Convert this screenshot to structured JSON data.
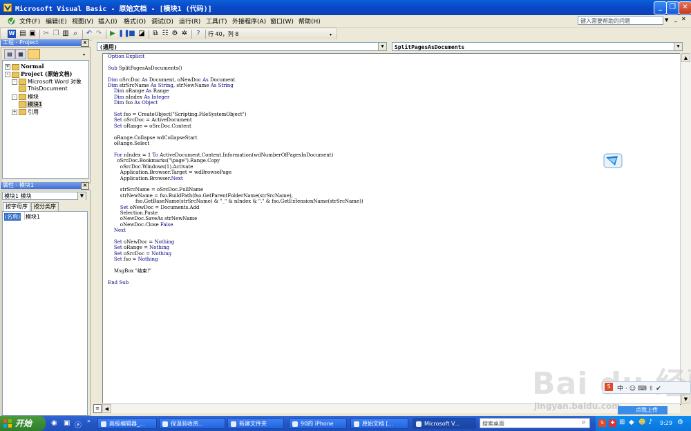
{
  "window": {
    "title": "Microsoft Visual Basic - 原始文档 - [模块1 (代码)]",
    "minimize": "_",
    "restore": "❐",
    "close": "✕"
  },
  "menu": {
    "items": [
      "文件(F)",
      "编辑(E)",
      "视图(V)",
      "插入(I)",
      "格式(O)",
      "调试(D)",
      "运行(R)",
      "工具(T)",
      "外接程序(A)",
      "窗口(W)",
      "帮助(H)"
    ],
    "help_placeholder": "键入需要帮助的问题"
  },
  "toolbar": {
    "cursor_position": "行 40，列 8"
  },
  "project_panel": {
    "title": "工程 - Project",
    "tree": [
      {
        "label": "Normal",
        "bold": true,
        "indent": 0,
        "expander": "+"
      },
      {
        "label": "Project (原始文档)",
        "bold": true,
        "indent": 0,
        "expander": "-"
      },
      {
        "label": "Microsoft Word 对象",
        "bold": false,
        "indent": 1,
        "expander": "-"
      },
      {
        "label": "ThisDocument",
        "bold": false,
        "indent": 2,
        "expander": ""
      },
      {
        "label": "模块",
        "bold": false,
        "indent": 1,
        "expander": "-"
      },
      {
        "label": "模块1",
        "bold": false,
        "indent": 2,
        "expander": ""
      },
      {
        "label": "引用",
        "bold": false,
        "indent": 1,
        "expander": "+"
      }
    ]
  },
  "properties_panel": {
    "title": "属性 - 模块1",
    "object": "模块1 模块",
    "tabs": [
      "按字母序",
      "按分类序"
    ],
    "name_key": "(名称)",
    "name_value": "模块1"
  },
  "code_window": {
    "object_combo": "(通用)",
    "procedure_combo": "SplitPagesAsDocuments",
    "lines": [
      "Option Explicit",
      "",
      "Sub SplitPagesAsDocuments()",
      "",
      "Dim oSrcDoc As Document, oNewDoc As Document",
      "Dim strSrcName As String, strNewName As String",
      "    Dim oRange As Range",
      "    Dim nIndex As Integer",
      "    Dim fso As Object",
      "",
      "    Set fso = CreateObject(\"Scripting.FileSystemObject\")",
      "    Set oSrcDoc = ActiveDocument",
      "    Set oRange = oSrcDoc.Content",
      "",
      "    oRange.Collapse wdCollapseStart",
      "    oRange.Select",
      "",
      "    For nIndex = 1 To ActiveDocument.Content.Information(wdNumberOfPagesInDocument)",
      "      oSrcDoc.Bookmarks(\"\\page\").Range.Copy",
      "        oSrcDoc.Windows(1).Activate",
      "        Application.Browser.Target = wdBrowsePage",
      "        Application.Browser.Next",
      "",
      "        strSrcName = oSrcDoc.FullName",
      "        strNewName = fso.BuildPath(fso.GetParentFolderName(strSrcName), _",
      "                  fso.GetBaseName(strSrcName) & \"_\" & nIndex & \".\" & fso.GetExtensionName(strSrcName))",
      "        Set oNewDoc = Documents.Add",
      "        Selection.Paste",
      "        oNewDoc.SaveAs strNewName",
      "        oNewDoc.Close False",
      "    Next",
      "",
      "    Set oNewDoc = Nothing",
      "    Set oRange = Nothing",
      "    Set oSrcDoc = Nothing",
      "    Set fso = Nothing",
      "",
      "    MsgBox \"结束!\"",
      "",
      "End Sub"
    ]
  },
  "taskbar": {
    "start": "开始",
    "tasks": [
      "高级编辑器_...",
      "保温验收资...",
      "新建文件夹",
      "90的 iPhone",
      "原始文档 [...",
      "Microsoft V..."
    ],
    "search_placeholder": "搜索桌面",
    "clock": "9:29",
    "upload_label": "点我上传"
  },
  "watermark": {
    "brand": "Bai du 经验",
    "url": "jingyan.baidu.com"
  }
}
